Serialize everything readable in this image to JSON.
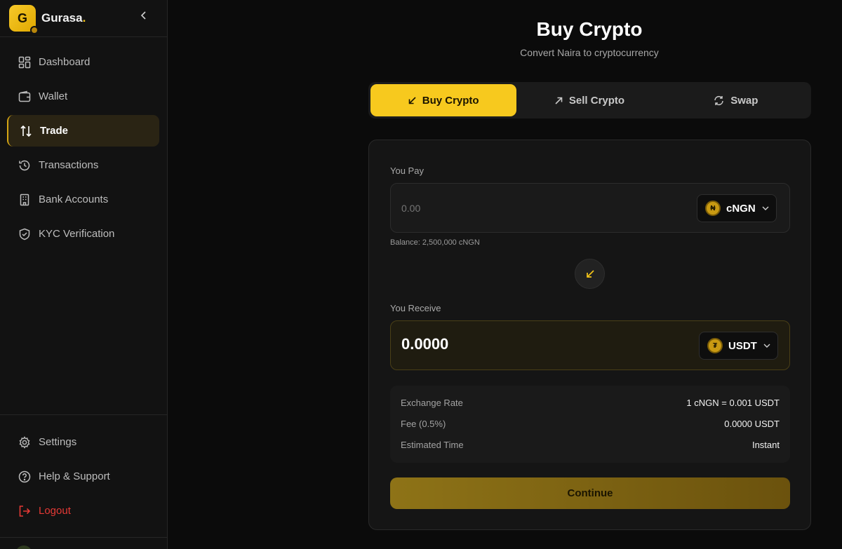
{
  "brand": {
    "logo_letter": "G",
    "name": "Gurasa",
    "name_dot": "."
  },
  "sidebar": {
    "items": [
      {
        "label": "Dashboard",
        "icon": "dashboard-icon"
      },
      {
        "label": "Wallet",
        "icon": "wallet-icon"
      },
      {
        "label": "Trade",
        "icon": "trade-arrows-icon",
        "active": true
      },
      {
        "label": "Transactions",
        "icon": "history-icon"
      },
      {
        "label": "Bank Accounts",
        "icon": "bank-icon"
      },
      {
        "label": "KYC Verification",
        "icon": "shield-check-icon"
      }
    ],
    "bottom_items": [
      {
        "label": "Settings",
        "icon": "gear-icon"
      },
      {
        "label": "Help & Support",
        "icon": "help-circle-icon"
      },
      {
        "label": "Logout",
        "icon": "logout-icon"
      }
    ]
  },
  "header": {
    "title": "Buy Crypto",
    "subtitle": "Convert Naira to cryptocurrency"
  },
  "tabs": [
    {
      "label": "Buy Crypto",
      "icon": "arrow-down-left-icon",
      "active": true
    },
    {
      "label": "Sell Crypto",
      "icon": "arrow-up-right-icon"
    },
    {
      "label": "Swap",
      "icon": "refresh-icon"
    }
  ],
  "pay": {
    "label": "You Pay",
    "placeholder": "0.00",
    "token": "cNGN",
    "token_symbol": "₦",
    "balance": "Balance: 2,500,000 cNGN"
  },
  "receive": {
    "label": "You Receive",
    "amount": "0.0000",
    "token": "USDT",
    "token_symbol": "₮"
  },
  "summary": {
    "rows": [
      {
        "key": "Exchange Rate",
        "value": "1 cNGN = 0.001 USDT"
      },
      {
        "key": "Fee (0.5%)",
        "value": "0.0000 USDT"
      },
      {
        "key": "Estimated Time",
        "value": "Instant"
      }
    ]
  },
  "continue_label": "Continue",
  "colors": {
    "accent": "#f7c91e",
    "logout": "#e53935",
    "background": "#0b0b0b"
  }
}
